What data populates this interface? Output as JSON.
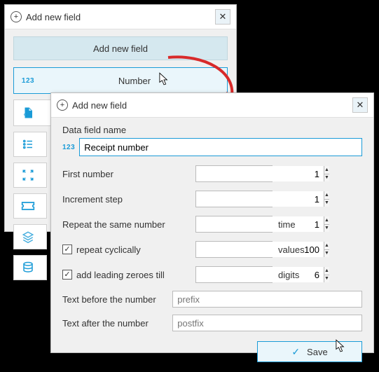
{
  "back": {
    "title": "Add new field",
    "addButton": "Add new field",
    "types": {
      "number": "Number",
      "dataFromFile": "Data from file"
    }
  },
  "front": {
    "title": "Add new field",
    "nameLabel": "Data field name",
    "nameValue": "Receipt number",
    "rows": {
      "first": {
        "label": "First number",
        "value": "1"
      },
      "step": {
        "label": "Increment step",
        "value": "1"
      },
      "repeat": {
        "label": "Repeat the same number",
        "value": "1",
        "unit": "time"
      },
      "cyclic": {
        "label": "repeat cyclically",
        "value": "100",
        "unit": "values",
        "checked": true
      },
      "leading": {
        "label": "add leading zeroes till",
        "value": "6",
        "unit": "digits",
        "checked": true
      },
      "before": {
        "label": "Text before the number",
        "placeholder": "prefix"
      },
      "after": {
        "label": "Text after the number",
        "placeholder": "postfix"
      }
    },
    "save": "Save"
  }
}
